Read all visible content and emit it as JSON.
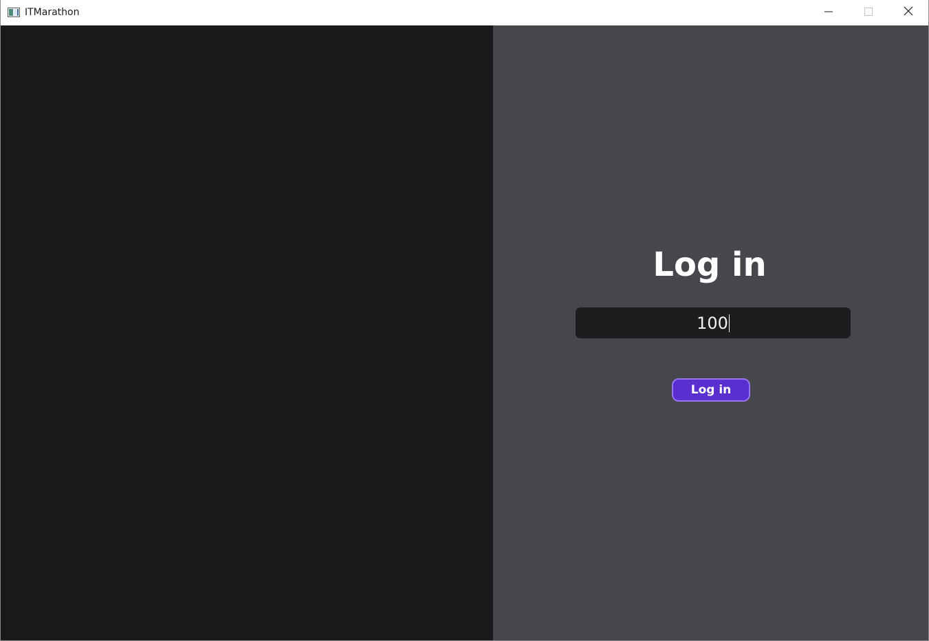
{
  "window": {
    "title": "ITMarathon",
    "icon": "app-window-icon",
    "controls": {
      "minimize_icon": "minimize-icon",
      "maximize_icon": "maximize-icon",
      "close_icon": "close-icon"
    }
  },
  "colors": {
    "left_pane": "#19191b",
    "right_pane": "#46464d",
    "field_bg": "#1d1d20",
    "button_bg": "#5a2ecf",
    "button_border": "#9a73f0",
    "text": "#ffffff"
  },
  "login": {
    "heading": "Log in",
    "field_value": "100",
    "button_label": "Log in"
  }
}
